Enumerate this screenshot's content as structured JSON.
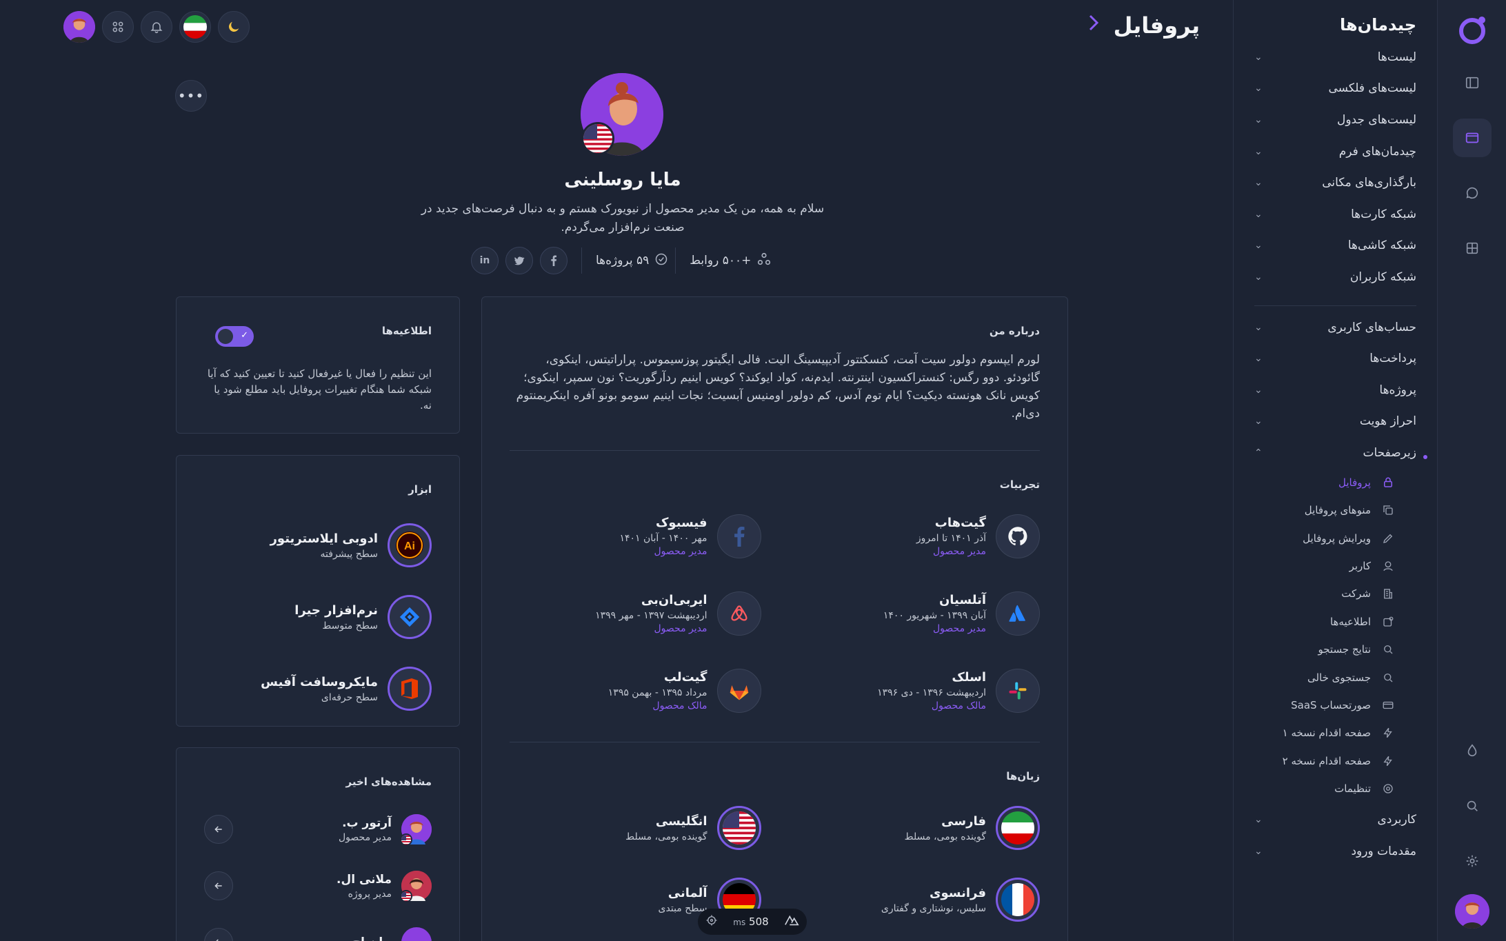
{
  "rail": {
    "icons": [
      "logo-icon",
      "sidebar-icon",
      "layout-icon",
      "chat-icon",
      "grid-icon",
      "drop-icon",
      "search-icon",
      "gear-icon"
    ]
  },
  "sidebar": {
    "title": "چیدمان‌ها",
    "items": [
      {
        "label": "لیست‌ها"
      },
      {
        "label": "لیست‌های فلکسی"
      },
      {
        "label": "لیست‌های جدول"
      },
      {
        "label": "چیدمان‌های فرم"
      },
      {
        "label": "بارگذاری‌های مکانی"
      },
      {
        "label": "شبکه کارت‌ها"
      },
      {
        "label": "شبکه کاشی‌ها"
      },
      {
        "label": "شبکه کاربران"
      }
    ],
    "items2": [
      {
        "label": "حساب‌های کاربری"
      },
      {
        "label": "پرداخت‌ها"
      },
      {
        "label": "پروژه‌ها"
      },
      {
        "label": "احراز هویت"
      },
      {
        "label": "زیرصفحات"
      }
    ],
    "subitems": [
      {
        "label": "پروفایل",
        "icon": "lock-icon"
      },
      {
        "label": "منوهای پروفایل",
        "icon": "copy-icon"
      },
      {
        "label": "ویرایش پروفایل",
        "icon": "pencil-icon"
      },
      {
        "label": "کاربر",
        "icon": "user-icon"
      },
      {
        "label": "شرکت",
        "icon": "building-icon"
      },
      {
        "label": "اطلاعیه‌ها",
        "icon": "notification-icon"
      },
      {
        "label": "نتایج جستجو",
        "icon": "search-icon"
      },
      {
        "label": "جستجوی خالی",
        "icon": "search-icon"
      },
      {
        "label": "صورتحساب SaaS",
        "icon": "card-icon"
      },
      {
        "label": "صفحه اقدام نسخه ۱",
        "icon": "bolt-icon"
      },
      {
        "label": "صفحه اقدام نسخه ۲",
        "icon": "bolt-icon"
      },
      {
        "label": "تنظیمات",
        "icon": "gear-icon"
      }
    ],
    "items3": [
      {
        "label": "کاربردی"
      },
      {
        "label": "مقدمات ورود"
      }
    ]
  },
  "header": {
    "title": "پروفایل"
  },
  "profile": {
    "name": "مایا روسلینی",
    "bio": "سلام به همه، من یک مدیر محصول از نیویورک هستم و به دنبال فرصت‌های جدید در صنعت نرم‌افزار می‌گردم.",
    "connections": "+۵۰۰ روابط",
    "projects": "۵۹ پروژه‌ها"
  },
  "about": {
    "title": "درباره من",
    "text": "لورم ایپسوم دولور سیت آمت، کنسکتتور آدیپیسینگ الیت. فالی ایگیتور پوزسیموس. پراراتیتس، اینکوی، گائودئو. دوو رگس: کنستراکسیون اینترنته. ایدم‌نه، کواد ایوکند؟ کویس اینیم ردآرگوریت؟ نون سمپر، اینکوی؛ کویس نانک هونسته دیکیت؟ ایام توم آدس، کم دولور اومنیس آبسیت؛ نجات اینیم سومو بونو آفره اینکریمنتوم دی‌ام."
  },
  "experiences": {
    "title": "تجربیات",
    "items": [
      {
        "name": "گیت‌هاب",
        "date": "آذر ۱۴۰۱ تا امروز",
        "role": "مدیر محصول",
        "icon": "github-icon"
      },
      {
        "name": "فیسبوک",
        "date": "مهر ۱۴۰۰ - آبان ۱۴۰۱",
        "role": "مدیر محصول",
        "icon": "facebook-icon"
      },
      {
        "name": "آتلسیان",
        "date": "آبان ۱۳۹۹ - شهریور ۱۴۰۰",
        "role": "مدیر محصول",
        "icon": "atlassian-icon"
      },
      {
        "name": "ایربی‌ان‌بی",
        "date": "اردیبهشت ۱۳۹۷ - مهر ۱۳۹۹",
        "role": "مدیر محصول",
        "icon": "airbnb-icon"
      },
      {
        "name": "اسلک",
        "date": "اردیبهشت ۱۳۹۶ - دی ۱۳۹۶",
        "role": "مالک محصول",
        "icon": "slack-icon"
      },
      {
        "name": "گیت‌لب",
        "date": "مرداد ۱۳۹۵ - بهمن ۱۳۹۵",
        "role": "مالک محصول",
        "icon": "gitlab-icon"
      }
    ]
  },
  "languages": {
    "title": "زبان‌ها",
    "items": [
      {
        "name": "فارسی",
        "level": "گوینده بومی، مسلط",
        "icon": "iran-flag-icon"
      },
      {
        "name": "انگلیسی",
        "level": "گوینده بومی، مسلط",
        "icon": "us-flag-icon"
      },
      {
        "name": "فرانسوی",
        "level": "سلیس، نوشتاری و گفتاری",
        "icon": "france-flag-icon"
      },
      {
        "name": "آلمانی",
        "level": "سطح مبتدی",
        "icon": "germany-flag-icon"
      }
    ]
  },
  "notifications": {
    "title": "اطلاعیه‌ها",
    "text": "این تنظیم را فعال یا غیرفعال کنید تا تعیین کنید که آیا شبکه شما هنگام تغییرات پروفایل باید مطلع شود یا نه.",
    "enabled": true
  },
  "tools": {
    "title": "ابزار",
    "items": [
      {
        "name": "ادوبی ایلاستریتور",
        "level": "سطح پیشرفته",
        "icon": "illustrator-icon"
      },
      {
        "name": "نرم‌افزار جیرا",
        "level": "سطح متوسط",
        "icon": "jira-icon"
      },
      {
        "name": "مایکروسافت آفیس",
        "level": "سطح حرفه‌ای",
        "icon": "office-icon"
      }
    ]
  },
  "recent": {
    "title": "مشاهده‌های اخیر",
    "items": [
      {
        "name": "آرتور ب.",
        "role": "مدیر محصول"
      },
      {
        "name": "ملانی ال.",
        "role": "مدیر پروژه"
      },
      {
        "name": "جان اچ.",
        "role": ""
      }
    ]
  },
  "perf": {
    "value": "508",
    "unit": "ms"
  },
  "colors": {
    "accent": "#8b5cf6",
    "background": "#1c2333",
    "card": "#1f2738"
  }
}
